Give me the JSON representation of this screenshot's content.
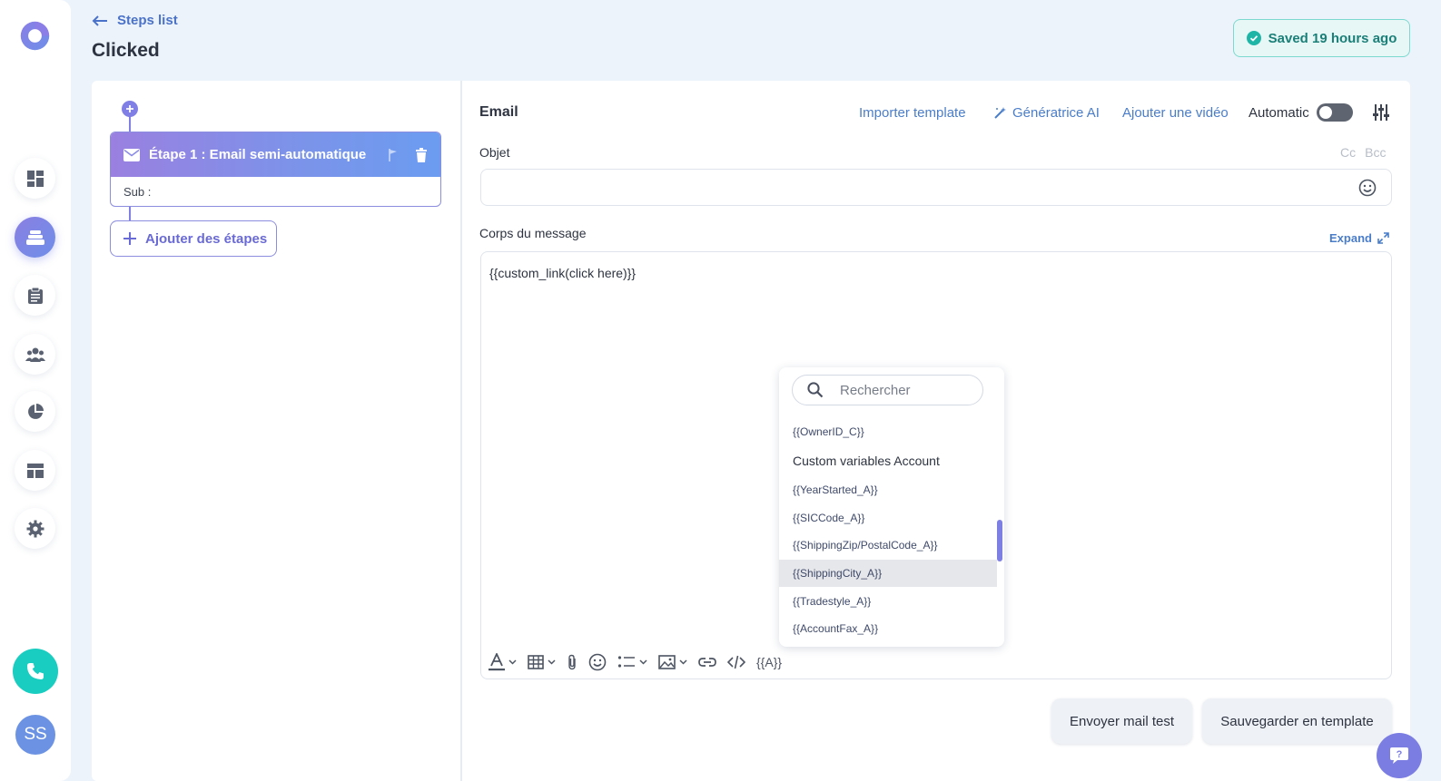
{
  "header": {
    "back_label": "Steps list",
    "title": "Clicked",
    "saved_status": "Saved 19 hours ago"
  },
  "nav": {
    "items": [
      "dashboard-icon",
      "sequences-icon",
      "tasks-icon",
      "contacts-icon",
      "reports-icon",
      "templates-icon",
      "settings-icon"
    ],
    "active": "sequences-icon",
    "avatar_initials": "SS"
  },
  "steps": {
    "step1_title": "Étape 1 : Email semi-automatique",
    "step1_sub": "Sub :",
    "add_label": "Ajouter des étapes"
  },
  "email": {
    "title": "Email",
    "import_template": "Importer template",
    "ai_generator": "Génératrice AI",
    "add_video": "Ajouter une vidéo",
    "automatic_label": "Automatic",
    "automatic_on": false,
    "subject_label": "Objet",
    "cc": "Cc",
    "bcc": "Bcc",
    "subject_value": "",
    "body_label": "Corps du message",
    "expand_label": "Expand",
    "body_text": "{{custom_link(click here)}}",
    "variable_button": "{{A}}"
  },
  "variables_dropdown": {
    "search_placeholder": "Rechercher",
    "items": [
      {
        "label": "{{OwnerID_C}}",
        "type": "option"
      },
      {
        "label": "Custom variables Account",
        "type": "group"
      },
      {
        "label": "{{YearStarted_A}}",
        "type": "option"
      },
      {
        "label": "{{SICCode_A}}",
        "type": "option"
      },
      {
        "label": "{{ShippingZip/PostalCode_A}}",
        "type": "option"
      },
      {
        "label": "{{ShippingCity_A}}",
        "type": "option",
        "selected": true
      },
      {
        "label": "{{Tradestyle_A}}",
        "type": "option"
      },
      {
        "label": "{{AccountFax_A}}",
        "type": "option"
      }
    ]
  },
  "actions": {
    "send_test": "Envoyer mail test",
    "save_template": "Sauvegarder en template"
  },
  "colors": {
    "accent": "#7f7fe5",
    "link": "#4a7dc9",
    "saved_green": "#1b7f78",
    "phone": "#19cdc0"
  }
}
